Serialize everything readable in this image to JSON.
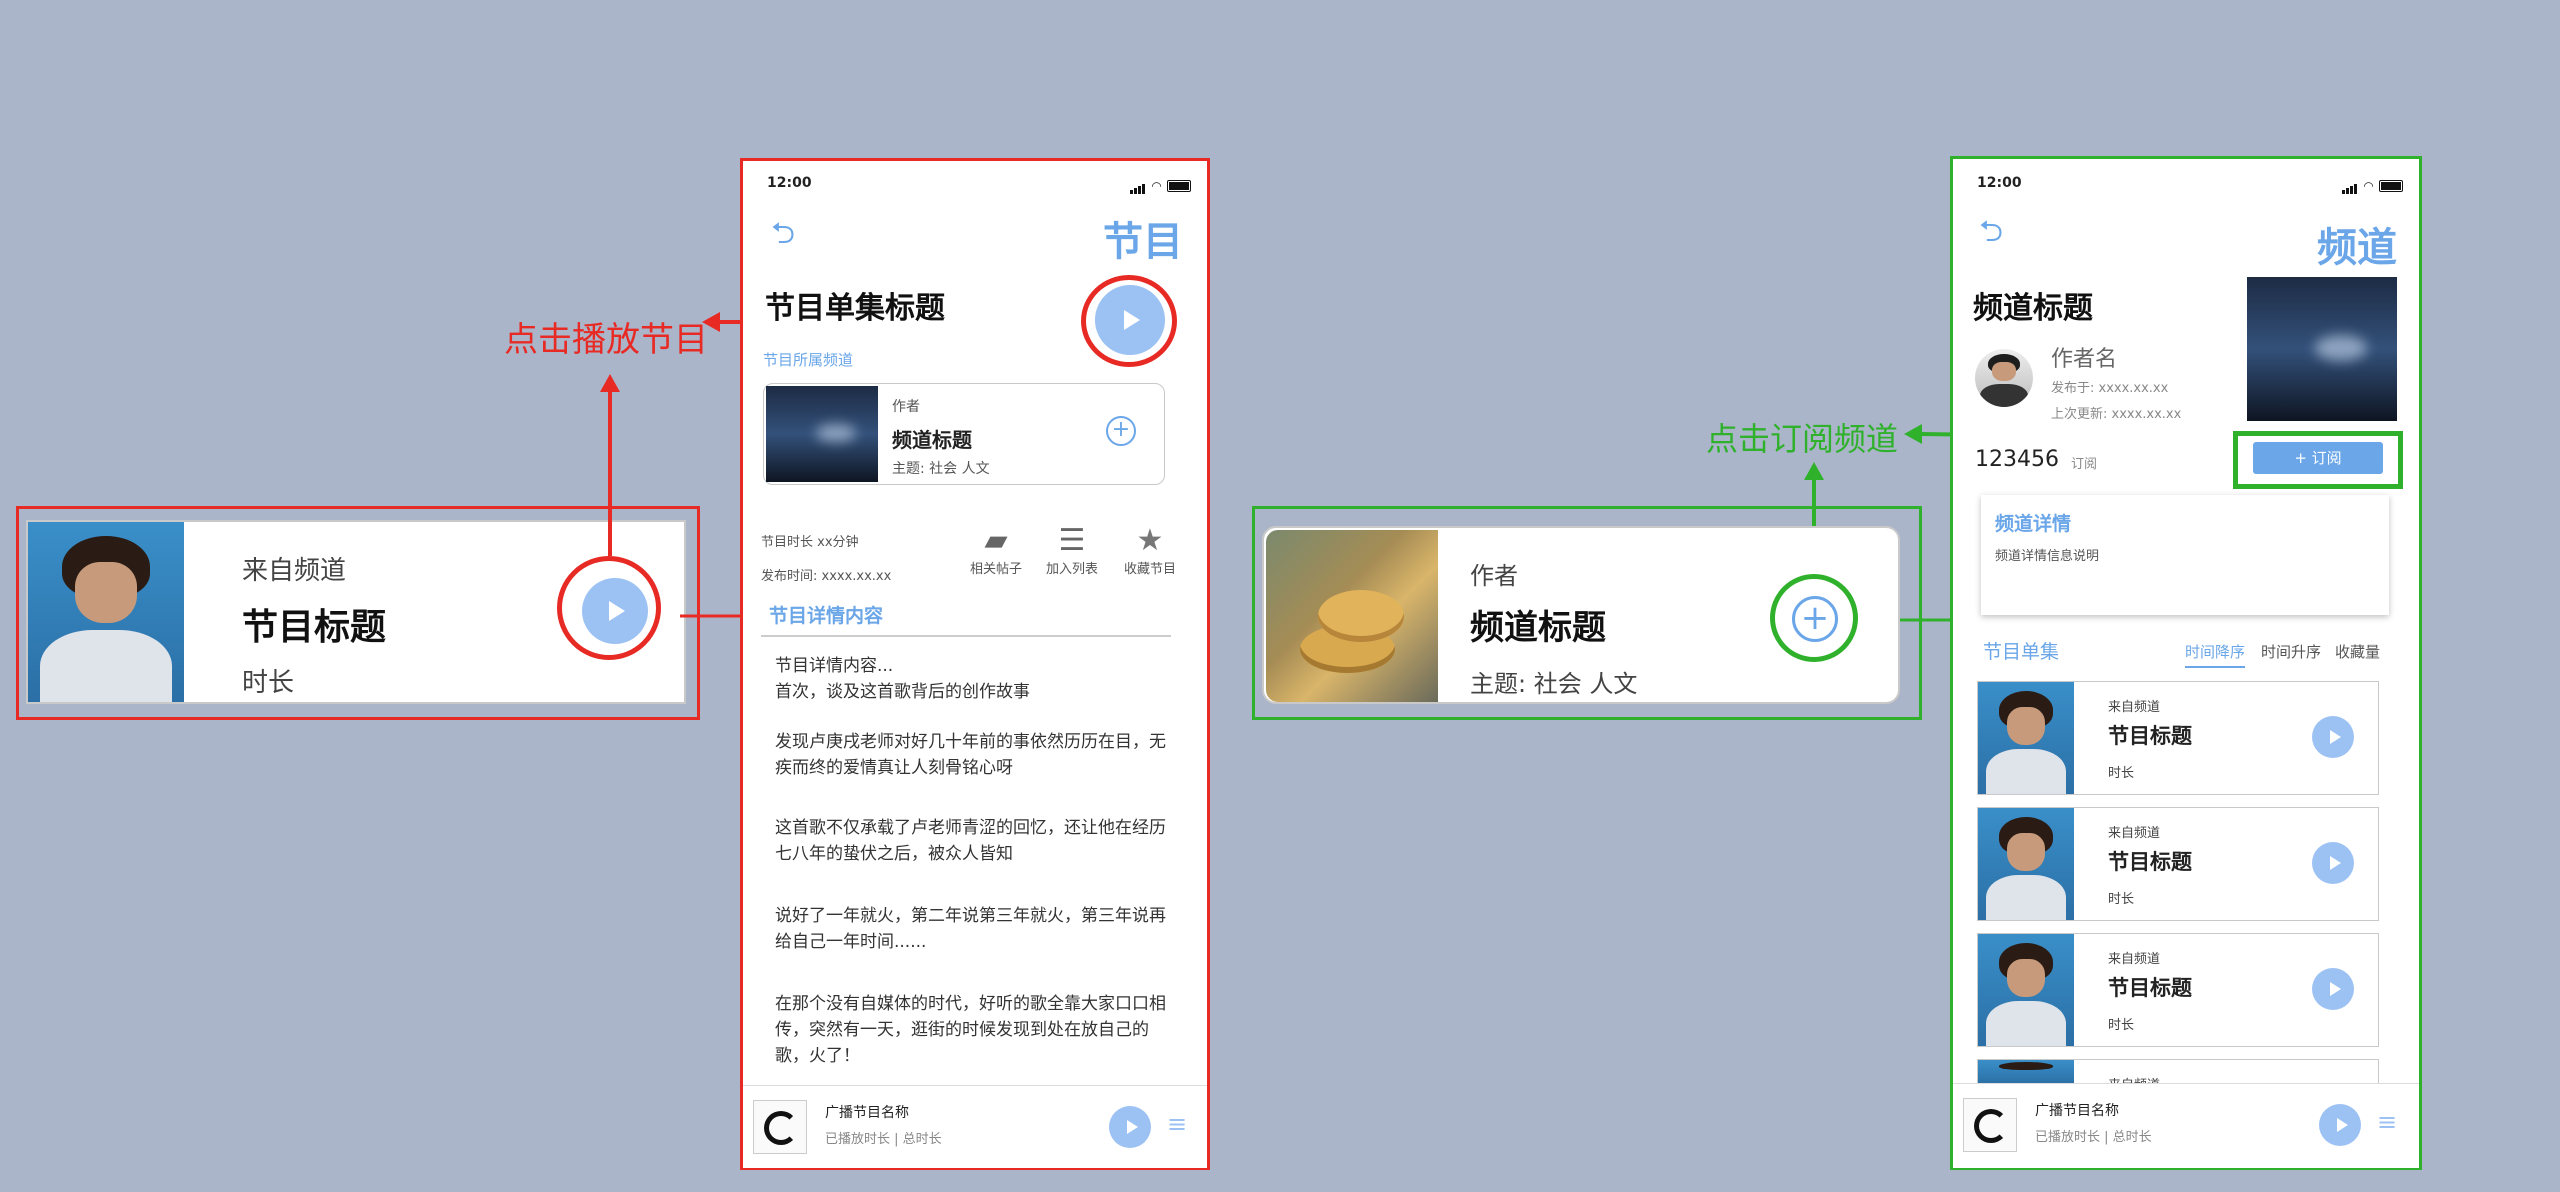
{
  "colors": {
    "background": "#abb5c9",
    "red": "#e82a24",
    "green": "#2fb12c",
    "accent_blue": "#6aa6e8",
    "play_blue": "#9cc2f4"
  },
  "annotations": {
    "play_label": "点击播放节目",
    "subscribe_label": "点击订阅频道"
  },
  "left_card": {
    "from_channel": "来自频道",
    "title": "节目标题",
    "duration": "时长"
  },
  "middle_card": {
    "author": "作者",
    "title": "频道标题",
    "topic": "主题: 社会 人文"
  },
  "program_screen": {
    "time": "12:00",
    "back_icon": "back-arrow-icon",
    "page_title": "节目",
    "episode_title": "节目单集标题",
    "channel_section_label": "节目所属频道",
    "channel_card": {
      "author": "作者",
      "title": "频道标题",
      "topic": "主题: 社会 人文"
    },
    "meta": {
      "duration": "节目时长 xx分钟",
      "published": "发布时间: xxxx.xx.xx"
    },
    "actions": [
      {
        "label": "相关帖子",
        "icon": "chat-icon"
      },
      {
        "label": "加入列表",
        "icon": "add-list-icon"
      },
      {
        "label": "收藏节目",
        "icon": "star-icon"
      }
    ],
    "detail_heading": "节目详情内容",
    "detail_paragraphs": [
      "节目详情内容...\n首次，谈及这首歌背后的创作故事",
      "发现卢庚戌老师对好几十年前的事依然历历在目，无疾而终的爱情真让人刻骨铭心呀",
      "这首歌不仅承载了卢老师青涩的回忆，还让他在经历七八年的蛰伏之后，被众人皆知",
      "说好了一年就火，第二年说第三年就火，第三年说再给自己一年时间......",
      "在那个没有自媒体的时代，好听的歌全靠大家口口相传，突然有一天，逛街的时候发现到处在放自己的歌，火了！"
    ],
    "player": {
      "name": "广播节目名称",
      "progress": "已播放时长 | 总时长"
    }
  },
  "channel_screen": {
    "time": "12:00",
    "page_title": "频道",
    "channel_title": "频道标题",
    "author_name": "作者名",
    "published": "发布于: xxxx.xx.xx",
    "updated": "上次更新: xxxx.xx.xx",
    "subscribers": "123456",
    "subscribers_unit": "订阅",
    "subscribe_button": "+ 订阅",
    "detail_title": "频道详情",
    "detail_desc": "频道详情信息说明",
    "episodes_label": "节目单集",
    "sort_tabs": [
      "时间降序",
      "时间升序",
      "收藏量"
    ],
    "episodes": [
      {
        "from": "来自频道",
        "title": "节目标题",
        "duration": "时长"
      },
      {
        "from": "来自频道",
        "title": "节目标题",
        "duration": "时长"
      },
      {
        "from": "来自频道",
        "title": "节目标题",
        "duration": "时长"
      },
      {
        "from": "来自频道"
      }
    ],
    "player": {
      "name": "广播节目名称",
      "progress": "已播放时长 | 总时长"
    }
  }
}
